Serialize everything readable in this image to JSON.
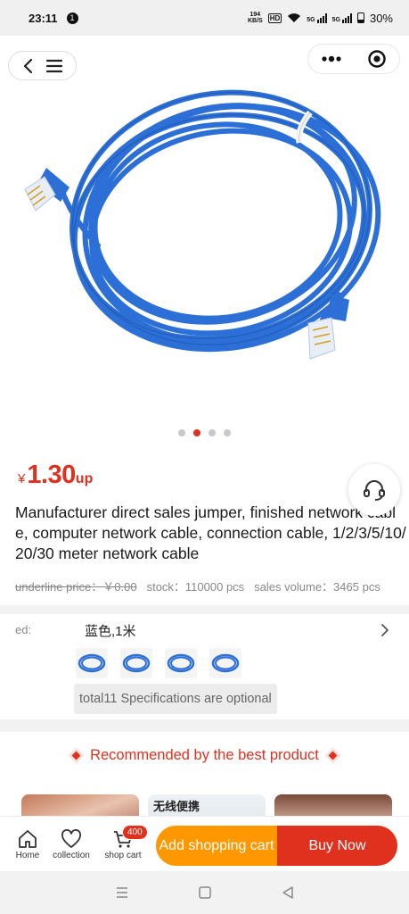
{
  "status_bar": {
    "time": "23:11",
    "notification_count": "1",
    "net_speed_value": "194",
    "net_speed_unit": "KB/S",
    "hd_label": "HD",
    "signal_label_1": "5G",
    "signal_label_2": "5G",
    "battery": "30%"
  },
  "gallery": {
    "total_images": 4,
    "active_index": 1,
    "subject": "blue network cable coil"
  },
  "product": {
    "currency": "¥",
    "price": "1.30",
    "price_suffix": "up",
    "title": "Manufacturer direct sales jumper, finished network cable, computer network cable, connection cable, 1/2/3/5/10/20/30 meter network cable",
    "underline_price": "underline price：￥0.00",
    "stock": "stock：110000 pcs",
    "sales_volume": "sales volume：3465 pcs"
  },
  "spec": {
    "label": "ed:",
    "selected": "蓝色,1米",
    "thumbnail_count": 4,
    "note": "total11 Specifications are optional"
  },
  "recommend": {
    "title": "Recommended by the best product",
    "card_2_text": "无线便携"
  },
  "action_bar": {
    "home": "Home",
    "collection": "collection",
    "cart": "shop cart",
    "cart_badge": "400",
    "add_cart": "Add shopping cart",
    "buy_now": "Buy Now"
  },
  "colors": {
    "accent_red": "#e0311f",
    "accent_orange": "#ff9800",
    "cable_blue": "#2c6fd6"
  }
}
